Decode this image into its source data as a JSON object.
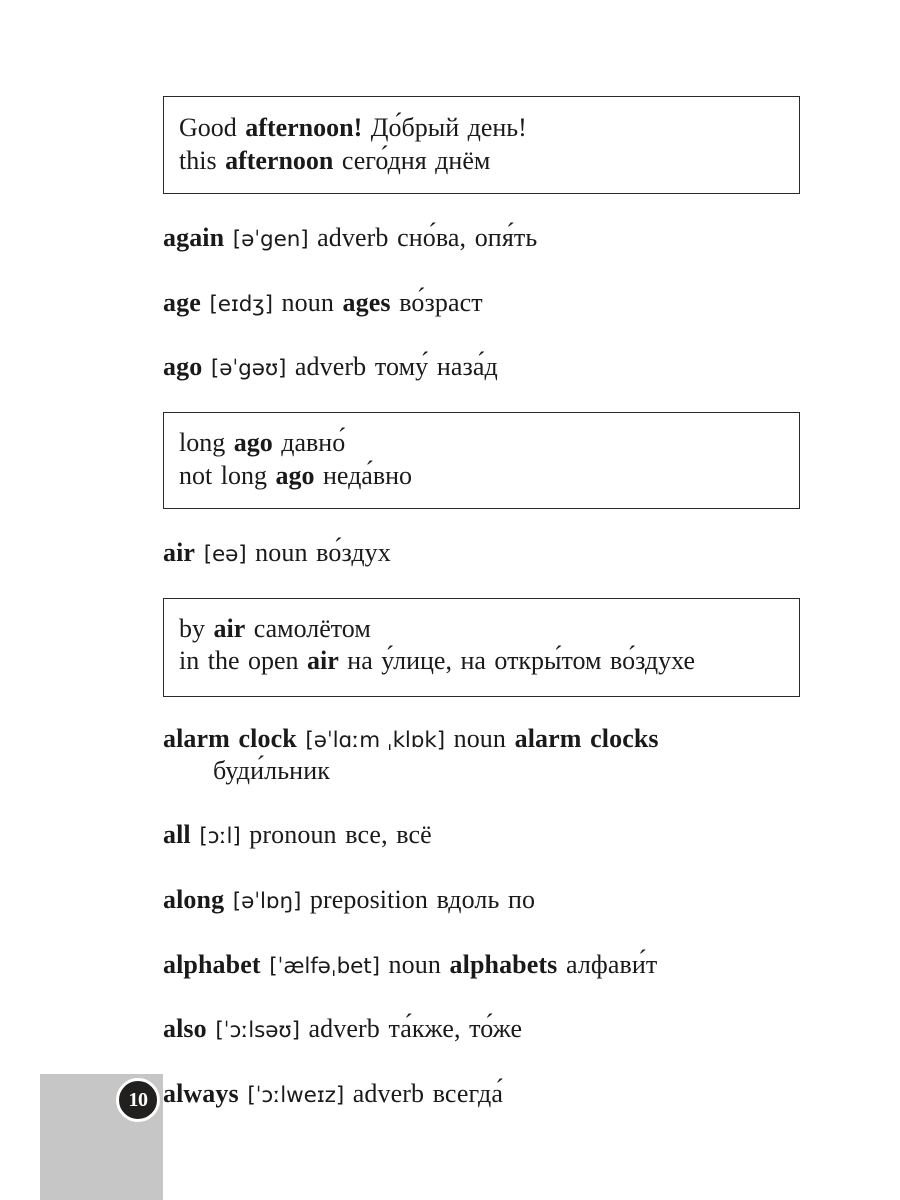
{
  "page": {
    "number": "10",
    "background_color": "#ffffff",
    "corner_color": "#c6c6c6",
    "badge_color": "#221f1f",
    "text_color": "#1a1a1a"
  },
  "blocks": [
    {
      "kind": "phrasebox",
      "name": "phrase-box-afternoon",
      "lines": [
        {
          "pre": "Good ",
          "bold": "afternoon!",
          "post": " До́брый день!"
        },
        {
          "pre": "this ",
          "bold": "afternoon",
          "post": " сего́дня днём"
        }
      ]
    },
    {
      "kind": "entry",
      "name": "entry-again",
      "headword": "again",
      "ipa": "[əˈgen]",
      "pos": "adverb",
      "plural": "",
      "gloss": "сно́ва, опя́ть",
      "continuation": ""
    },
    {
      "kind": "entry",
      "name": "entry-age",
      "headword": "age",
      "ipa": "[eɪdʒ]",
      "pos": "noun",
      "plural": "ages",
      "gloss": "во́зраст",
      "continuation": ""
    },
    {
      "kind": "entry",
      "name": "entry-ago",
      "headword": "ago",
      "ipa": "[əˈgəʊ]",
      "pos": "adverb",
      "plural": "",
      "gloss": "тому́ наза́д",
      "continuation": ""
    },
    {
      "kind": "phrasebox",
      "name": "phrase-box-ago",
      "lines": [
        {
          "pre": "long ",
          "bold": "ago",
          "post": " давно́"
        },
        {
          "pre": "not long ",
          "bold": "ago",
          "post": " неда́вно"
        }
      ]
    },
    {
      "kind": "entry",
      "name": "entry-air",
      "headword": "air",
      "ipa": "[eə]",
      "pos": "noun",
      "plural": "",
      "gloss": "во́здух",
      "continuation": ""
    },
    {
      "kind": "phrasebox",
      "name": "phrase-box-air",
      "lines": [
        {
          "pre": "by ",
          "bold": "air",
          "post": " самолётом"
        },
        {
          "pre": "in the open ",
          "bold": "air",
          "post": " на у́лице, на откры́том во́здухе"
        }
      ]
    },
    {
      "kind": "entry",
      "name": "entry-alarm-clock",
      "headword": "alarm clock",
      "ipa": "[əˈlɑːm ˌklɒk]",
      "pos": "noun",
      "plural": "alarm clocks",
      "gloss": "",
      "continuation": "буди́льник"
    },
    {
      "kind": "entry",
      "name": "entry-all",
      "headword": "all",
      "ipa": "[ɔːl]",
      "pos": "pronoun",
      "plural": "",
      "gloss": "все, всё",
      "continuation": ""
    },
    {
      "kind": "entry",
      "name": "entry-along",
      "headword": "along",
      "ipa": "[əˈlɒŋ]",
      "pos": "preposition",
      "plural": "",
      "gloss": "вдоль по",
      "continuation": ""
    },
    {
      "kind": "entry",
      "name": "entry-alphabet",
      "headword": "alphabet",
      "ipa": "[ˈælfəˌbet]",
      "pos": "noun",
      "plural": "alphabets",
      "gloss": "алфави́т",
      "continuation": ""
    },
    {
      "kind": "entry",
      "name": "entry-also",
      "headword": "also",
      "ipa": "[ˈɔːlsəʊ]",
      "pos": "adverb",
      "plural": "",
      "gloss": "та́кже, то́же",
      "continuation": ""
    },
    {
      "kind": "entry",
      "name": "entry-always",
      "headword": "always",
      "ipa": "[ˈɔːlweɪz]",
      "pos": "adverb",
      "plural": "",
      "gloss": "всегда́",
      "continuation": ""
    }
  ]
}
